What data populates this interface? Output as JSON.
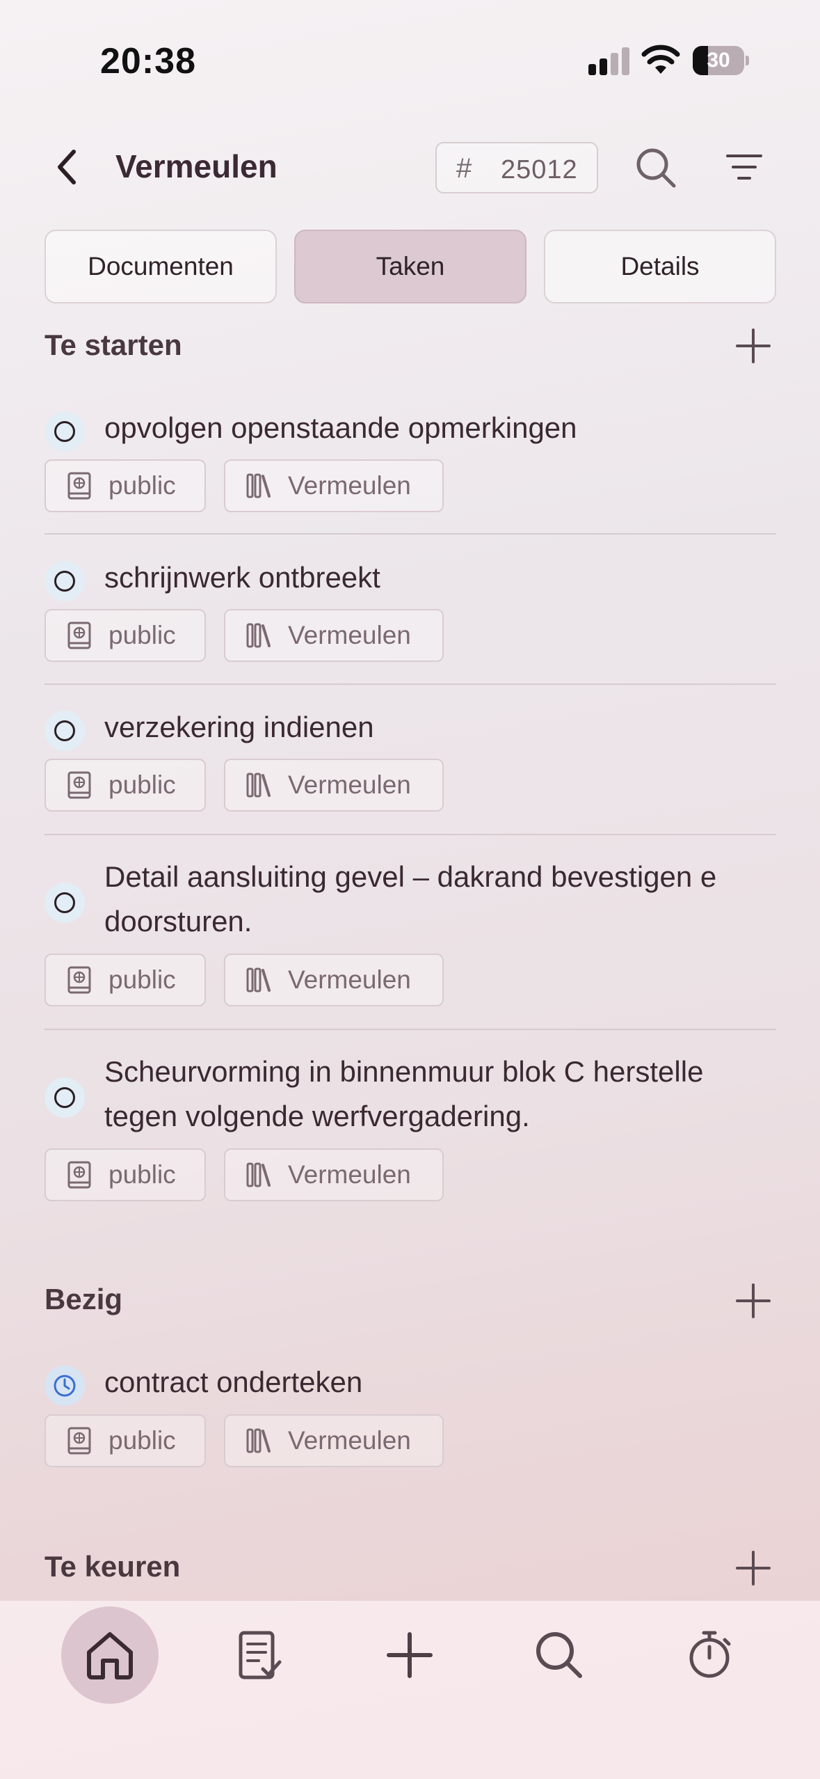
{
  "status_bar": {
    "time": "20:38",
    "battery": "30",
    "battery_level": 0.3
  },
  "header": {
    "back_icon": "chevron-left-icon",
    "title": "Vermeulen",
    "project_hash": "#",
    "project_number": "25012"
  },
  "tabs": [
    {
      "label": "Documenten",
      "active": false
    },
    {
      "label": "Taken",
      "active": true
    },
    {
      "label": "Details",
      "active": false
    }
  ],
  "sections": [
    {
      "title": "Te starten",
      "tasks": [
        {
          "lines": [
            "opvolgen openstaande opmerkingen"
          ],
          "status": "open",
          "visibility": "public",
          "project": "Vermeulen"
        },
        {
          "lines": [
            "schrijnwerk ontbreekt"
          ],
          "status": "open",
          "visibility": "public",
          "project": "Vermeulen"
        },
        {
          "lines": [
            "verzekering indienen"
          ],
          "status": "open",
          "visibility": "public",
          "project": "Vermeulen"
        },
        {
          "lines": [
            "Detail aansluiting gevel – dakrand bevestigen e",
            "doorsturen."
          ],
          "status": "open",
          "visibility": "public",
          "project": "Vermeulen"
        },
        {
          "lines": [
            "Scheurvorming in binnenmuur blok C herstelle",
            "tegen volgende werfvergadering."
          ],
          "status": "open",
          "visibility": "public",
          "project": "Vermeulen"
        }
      ]
    },
    {
      "title": "Bezig",
      "tasks": [
        {
          "lines": [
            "contract onderteken"
          ],
          "status": "in-progress",
          "visibility": "public",
          "project": "Vermeulen"
        }
      ]
    },
    {
      "title": "Te keuren",
      "tasks": []
    }
  ],
  "nav": [
    {
      "icon": "home-icon",
      "active": true
    },
    {
      "icon": "task-list-icon",
      "active": false
    },
    {
      "icon": "plus-icon",
      "active": false
    },
    {
      "icon": "search-icon",
      "active": false
    },
    {
      "icon": "timer-icon",
      "active": false
    }
  ],
  "colors": {
    "accent": "#dcc9d1",
    "text": "#3a2931",
    "muted": "#7a6970",
    "in_progress": "#3a6fd0"
  }
}
